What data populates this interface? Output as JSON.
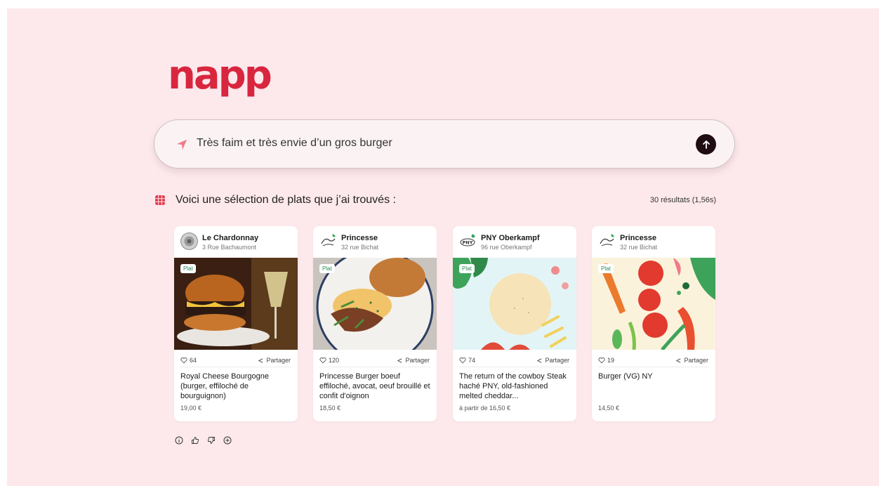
{
  "brand": {
    "logo_text": "napp"
  },
  "search": {
    "query": "Très faim et très envie d’un gros burger"
  },
  "results": {
    "title": "Voici une sélection de plats que j’ai trouvés :",
    "count_text": "30 résultats (1,56s)"
  },
  "cards": [
    {
      "restaurant": "Le Chardonnay",
      "address": "3 Rue Bachaumont",
      "tag": "Plat",
      "likes": "64",
      "share": "Partager",
      "dish": "Royal Cheese Bourgogne (burger, effiloché de bourguignon)",
      "price": "19,00 €"
    },
    {
      "restaurant": "Princesse",
      "address": "32 rue Bichat",
      "tag": "Plat",
      "likes": "120",
      "share": "Partager",
      "dish": "Princesse Burger boeuf effiloché, avocat, oeuf brouillé et confit d'oignon",
      "price": "18,50 €"
    },
    {
      "restaurant": "PNY Oberkampf",
      "address": "96 rue Oberkampf",
      "tag": "Plat",
      "likes": "74",
      "share": "Partager",
      "dish": "The return of the cowboy Steak haché PNY, old-fashioned melted cheddar...",
      "price": "à partir de 16,50 €"
    },
    {
      "restaurant": "Princesse",
      "address": "32 rue Bichat",
      "tag": "Plat",
      "likes": "19",
      "share": "Partager",
      "dish": "Burger (VG) NY",
      "price": "14,50 €"
    }
  ],
  "colors": {
    "background": "#fde9ec",
    "brand": "#d9263f",
    "send_button": "#1f0d13",
    "tag_text": "#2c8c59"
  },
  "icons": {
    "search": "navigation-arrow-icon",
    "send": "arrow-up-icon",
    "section": "grid-icon",
    "like": "heart-icon",
    "share": "share-icon",
    "feedback": [
      "info-icon",
      "thumbs-up-icon",
      "thumbs-down-icon",
      "plus-circle-icon"
    ]
  }
}
